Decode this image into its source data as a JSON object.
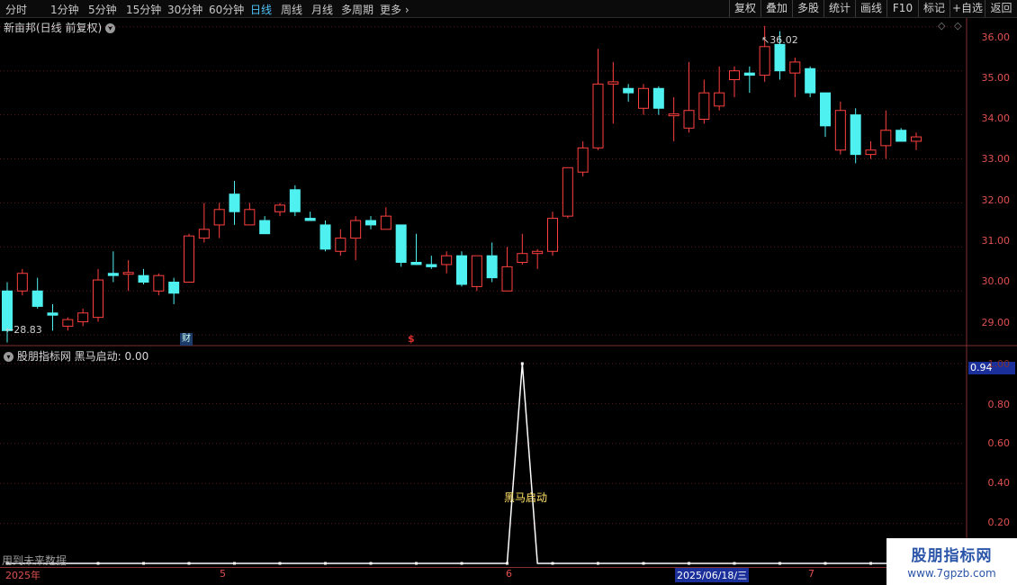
{
  "toolbar": {
    "periods": [
      "分时",
      "1分钟",
      "5分钟",
      "15分钟",
      "30分钟",
      "60分钟",
      "日线",
      "周线",
      "月线",
      "多周期",
      "更多"
    ],
    "active_period": "日线",
    "right_tools": [
      "复权",
      "叠加",
      "多股",
      "统计",
      "画线",
      "F10",
      "标记",
      "+自选",
      "返回"
    ]
  },
  "main": {
    "title": "新亩邦(日线 前复权)",
    "high_label": "36.02",
    "low_label": "28.83",
    "y_ticks": [
      "36.00",
      "35.00",
      "34.00",
      "33.00",
      "32.00",
      "31.00",
      "30.00",
      "29.00"
    ],
    "marker_cai": "财",
    "marker_dollar": "$"
  },
  "indicator": {
    "title": "股朋指标网 黑马启动: 0.00",
    "current_value": "0.94",
    "y_ticks": [
      "1.00",
      "0.80",
      "0.60",
      "0.40",
      "0.20"
    ],
    "signal_label": "黑马启动",
    "warning": "用到未来数据"
  },
  "time_axis": {
    "start": "2025年",
    "ticks": [
      "5",
      "6",
      "7"
    ],
    "cursor_date": "2025/06/18/三"
  },
  "colors": {
    "up": "#ff4040",
    "down": "#4ff0f0",
    "axis": "#803030",
    "grid": "#5a1a1a"
  },
  "watermark": {
    "line1": "股朋指标网",
    "line2": "www.7gpzb.com"
  },
  "chart_data": {
    "type": "candlestick",
    "ohlc": [
      [
        30.0,
        30.2,
        28.83,
        29.1
      ],
      [
        30.0,
        30.5,
        29.9,
        30.4
      ],
      [
        30.0,
        30.3,
        29.6,
        29.65
      ],
      [
        29.5,
        29.7,
        29.1,
        29.45
      ],
      [
        29.2,
        29.4,
        29.1,
        29.35
      ],
      [
        29.3,
        29.6,
        29.2,
        29.5
      ],
      [
        29.4,
        30.5,
        29.3,
        30.25
      ],
      [
        30.4,
        30.9,
        30.2,
        30.35
      ],
      [
        30.4,
        30.7,
        30.0,
        30.4
      ],
      [
        30.35,
        30.5,
        30.15,
        30.2
      ],
      [
        30.0,
        30.4,
        29.9,
        30.35
      ],
      [
        30.2,
        30.3,
        29.7,
        29.95
      ],
      [
        30.2,
        31.3,
        30.2,
        31.25
      ],
      [
        31.2,
        32.0,
        31.1,
        31.4
      ],
      [
        31.5,
        32.0,
        31.2,
        31.85
      ],
      [
        32.2,
        32.5,
        31.5,
        31.8
      ],
      [
        31.5,
        32.0,
        31.5,
        31.85
      ],
      [
        31.6,
        31.7,
        31.3,
        31.3
      ],
      [
        31.8,
        32.0,
        31.7,
        31.95
      ],
      [
        32.3,
        32.4,
        31.7,
        31.8
      ],
      [
        31.65,
        31.8,
        31.6,
        31.6
      ],
      [
        31.5,
        31.6,
        30.9,
        30.95
      ],
      [
        30.9,
        31.4,
        30.8,
        31.2
      ],
      [
        31.2,
        31.7,
        30.7,
        31.6
      ],
      [
        31.6,
        31.7,
        31.4,
        31.5
      ],
      [
        31.4,
        31.9,
        31.4,
        31.7
      ],
      [
        31.5,
        31.5,
        30.55,
        30.65
      ],
      [
        30.65,
        31.3,
        30.6,
        30.6
      ],
      [
        30.6,
        30.8,
        30.5,
        30.55
      ],
      [
        30.6,
        30.9,
        30.4,
        30.8
      ],
      [
        30.8,
        30.9,
        30.1,
        30.15
      ],
      [
        30.1,
        30.8,
        30.0,
        30.8
      ],
      [
        30.8,
        31.1,
        30.2,
        30.3
      ],
      [
        30.0,
        31.0,
        30.0,
        30.55
      ],
      [
        30.65,
        31.3,
        30.6,
        30.85
      ],
      [
        30.85,
        30.95,
        30.5,
        30.9
      ],
      [
        30.9,
        31.8,
        30.8,
        31.65
      ],
      [
        31.7,
        32.5,
        31.65,
        32.8
      ],
      [
        32.7,
        33.4,
        32.6,
        33.25
      ],
      [
        33.25,
        35.5,
        33.2,
        34.7
      ],
      [
        34.7,
        35.2,
        33.8,
        34.75
      ],
      [
        34.6,
        34.7,
        34.3,
        34.5
      ],
      [
        34.15,
        34.7,
        34.0,
        34.6
      ],
      [
        34.6,
        34.65,
        34.0,
        34.15
      ],
      [
        34.0,
        34.4,
        33.4,
        34.0
      ],
      [
        33.7,
        35.2,
        33.6,
        34.1
      ],
      [
        33.9,
        34.8,
        33.8,
        34.5
      ],
      [
        34.2,
        35.1,
        34.1,
        34.5
      ],
      [
        34.8,
        35.1,
        34.4,
        35.0
      ],
      [
        34.95,
        35.1,
        34.5,
        34.9
      ],
      [
        34.9,
        36.02,
        34.75,
        35.55
      ],
      [
        35.6,
        35.9,
        34.8,
        35.0
      ],
      [
        34.95,
        35.3,
        34.4,
        35.2
      ],
      [
        35.05,
        35.1,
        34.4,
        34.5
      ],
      [
        34.5,
        34.5,
        33.5,
        33.75
      ],
      [
        33.2,
        34.3,
        33.1,
        34.1
      ],
      [
        34.0,
        34.15,
        32.9,
        33.1
      ],
      [
        33.1,
        33.4,
        33.0,
        33.2
      ],
      [
        33.3,
        34.1,
        33.0,
        33.65
      ],
      [
        33.65,
        33.7,
        33.4,
        33.4
      ],
      [
        33.4,
        33.6,
        33.2,
        33.5
      ]
    ],
    "price_range": [
      28.8,
      36.2
    ],
    "indicator_name": "黑马启动",
    "indicator_values": [
      0,
      0,
      0,
      0,
      0,
      0,
      0,
      0,
      0,
      0,
      0,
      0,
      0,
      0,
      0,
      0,
      0,
      0,
      0,
      0,
      0,
      0,
      0,
      0,
      0,
      0,
      0,
      0,
      0,
      0,
      0,
      0,
      0,
      0,
      1.0,
      0,
      0,
      0,
      0,
      0,
      0,
      0,
      0,
      0,
      0,
      0,
      0,
      0,
      0,
      0,
      0,
      0,
      0,
      0,
      0,
      0,
      0,
      0,
      0,
      0,
      0
    ],
    "indicator_range": [
      0,
      1.0
    ]
  }
}
